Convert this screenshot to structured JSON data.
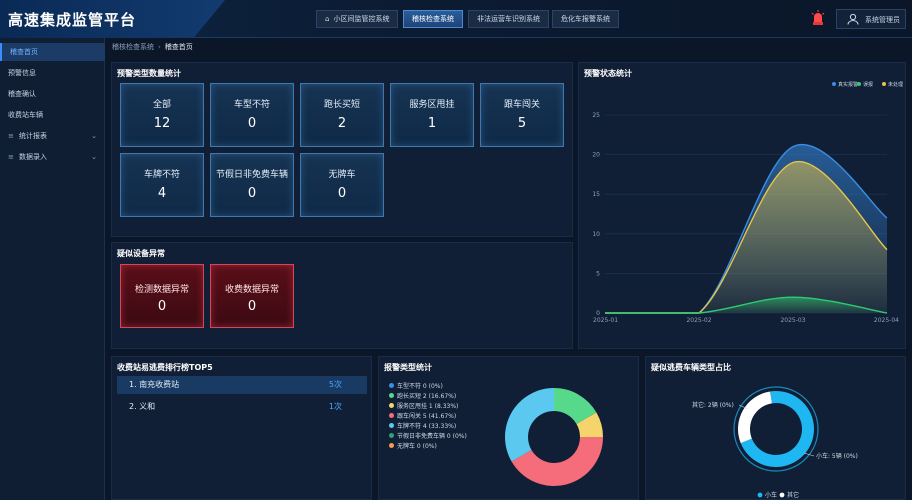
{
  "header": {
    "title": "高速集成监管平台",
    "nav": [
      {
        "label": "小区间监管控系统",
        "active": false
      },
      {
        "label": "稽核检查系统",
        "active": true
      },
      {
        "label": "非法运营车识别系统",
        "active": false
      },
      {
        "label": "危化车报警系统",
        "active": false
      }
    ],
    "user": "系统管理员"
  },
  "sidebar": {
    "items": [
      {
        "label": "稽查首页",
        "active": true
      },
      {
        "label": "预警信息"
      },
      {
        "label": "稽查确认"
      },
      {
        "label": "收费站车辆"
      },
      {
        "label": "统计报表",
        "expandable": true
      },
      {
        "label": "数据录入",
        "expandable": true
      }
    ]
  },
  "breadcrumb": {
    "parent": "稽核检查系统",
    "current": "稽查首页"
  },
  "warning_types": {
    "title": "预警类型数量统计",
    "cards": [
      {
        "label": "全部",
        "value": "12"
      },
      {
        "label": "车型不符",
        "value": "0"
      },
      {
        "label": "跑长买短",
        "value": "2"
      },
      {
        "label": "服务区甩挂",
        "value": "1"
      },
      {
        "label": "跟车闯关",
        "value": "5"
      },
      {
        "label": "车牌不符",
        "value": "4"
      },
      {
        "label": "节假日非免费车辆",
        "value": "0"
      },
      {
        "label": "无牌车",
        "value": "0"
      }
    ]
  },
  "device_anomaly": {
    "title": "疑似设备异常",
    "cards": [
      {
        "label": "检测数据异常",
        "value": "0"
      },
      {
        "label": "收费数据异常",
        "value": "0"
      }
    ]
  },
  "warning_status": {
    "title": "预警状态统计",
    "chart_data": {
      "type": "area",
      "x": [
        "2025-01",
        "2025-02",
        "2025-03",
        "2025-04"
      ],
      "ylim": [
        0,
        25
      ],
      "yticks": [
        "0",
        "5",
        "10",
        "15",
        "20",
        "25"
      ],
      "legend_position": "top-right",
      "series": [
        {
          "name": "真实报警",
          "color": "#3a8ee6",
          "values": [
            0,
            0,
            21,
            12
          ]
        },
        {
          "name": "误报",
          "color": "#2ecc71",
          "values": [
            0,
            0,
            2,
            0
          ]
        },
        {
          "name": "未处理",
          "color": "#e8c547",
          "values": [
            0,
            0,
            19,
            8
          ]
        }
      ]
    }
  },
  "toll_rank": {
    "title": "收费站易逃费排行榜TOP5",
    "rows": [
      {
        "rank_name": "1. 南充收费站",
        "count": "5次"
      },
      {
        "rank_name": "2. 义和",
        "count": "1次"
      }
    ]
  },
  "alarm_types": {
    "title": "报警类型统计",
    "chart_data": {
      "type": "pie",
      "legend_position": "left",
      "categories": [
        "车型不符 0 (0%)",
        "跑长买短 2 (16.67%)",
        "服务区甩挂 1 (8.33%)",
        "跟车闯关 5 (41.67%)",
        "车牌不符 4 (33.33%)",
        "节假日非免费车辆 0 (0%)",
        "无牌车 0 (0%)"
      ],
      "values": [
        0,
        2,
        1,
        5,
        4,
        0,
        0
      ],
      "colors": [
        "#3a8ee6",
        "#56d98a",
        "#f5d56b",
        "#f56c7a",
        "#5bc8f0",
        "#2ea37a",
        "#f39c4a"
      ]
    }
  },
  "vehicle_types": {
    "title": "疑似逃费车辆类型占比",
    "chart_data": {
      "type": "pie",
      "legend_position": "bottom",
      "categories": [
        "小车",
        "其它"
      ],
      "values": [
        5,
        2
      ],
      "labels": [
        "小车: 5辆 (0%)",
        "其它: 2辆 (0%)"
      ],
      "colors": [
        "#1fb7f2",
        "#ffffff"
      ]
    }
  }
}
